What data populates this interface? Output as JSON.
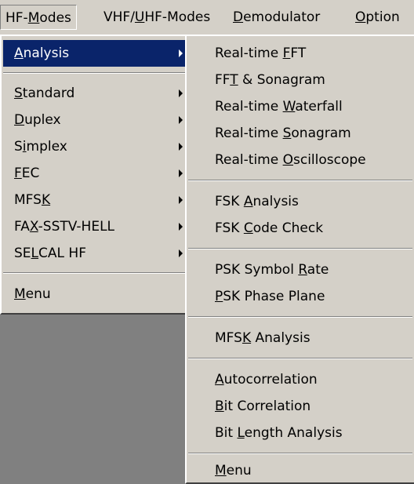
{
  "menubar": {
    "items": [
      {
        "label": "HF-Modes",
        "mnemonic": "M"
      },
      {
        "label": "VHF/UHF-Modes",
        "mnemonic": "U"
      },
      {
        "label": "Demodulator",
        "mnemonic": "D"
      },
      {
        "label": "Option",
        "mnemonic": "O"
      }
    ]
  },
  "hf_menu": {
    "items": [
      {
        "label": "Analysis",
        "mnemonic": "A",
        "submenu": true,
        "selected": true
      },
      {
        "label": "Standard",
        "mnemonic": "S",
        "submenu": true
      },
      {
        "label": "Duplex",
        "mnemonic": "D",
        "submenu": true
      },
      {
        "label": "Simplex",
        "mnemonic": "i",
        "submenu": true
      },
      {
        "label": "FEC",
        "mnemonic": "F",
        "submenu": true
      },
      {
        "label": "MFSK",
        "mnemonic": "K",
        "submenu": true
      },
      {
        "label": "FAX-SSTV-HELL",
        "mnemonic": "X",
        "submenu": true
      },
      {
        "label": "SELCAL HF",
        "mnemonic": "L",
        "submenu": true
      },
      {
        "label": "Menu",
        "mnemonic": "M",
        "submenu": false
      }
    ]
  },
  "analysis_submenu": {
    "items": [
      {
        "label": "Real-time FFT",
        "mnemonic": "F"
      },
      {
        "label": "FFT & Sonagram",
        "mnemonic": "T"
      },
      {
        "label": "Real-time Waterfall",
        "mnemonic": "W"
      },
      {
        "label": "Real-time Sonagram",
        "mnemonic": "S"
      },
      {
        "label": "Real-time Oscilloscope",
        "mnemonic": "O"
      },
      {
        "label": "FSK Analysis",
        "mnemonic": "A"
      },
      {
        "label": "FSK Code Check",
        "mnemonic": "C"
      },
      {
        "label": "PSK Symbol Rate",
        "mnemonic": "R"
      },
      {
        "label": "PSK Phase Plane",
        "mnemonic": "P"
      },
      {
        "label": "MFSK Analysis",
        "mnemonic": "K"
      },
      {
        "label": "Autocorrelation",
        "mnemonic": "A"
      },
      {
        "label": "Bit Correlation",
        "mnemonic": "B"
      },
      {
        "label": "Bit Length Analysis",
        "mnemonic": "L"
      },
      {
        "label": "Menu",
        "mnemonic": "M"
      }
    ]
  },
  "colors": {
    "menu_face": "#d4d0c8",
    "selection": "#0a246a",
    "background": "#808080"
  }
}
